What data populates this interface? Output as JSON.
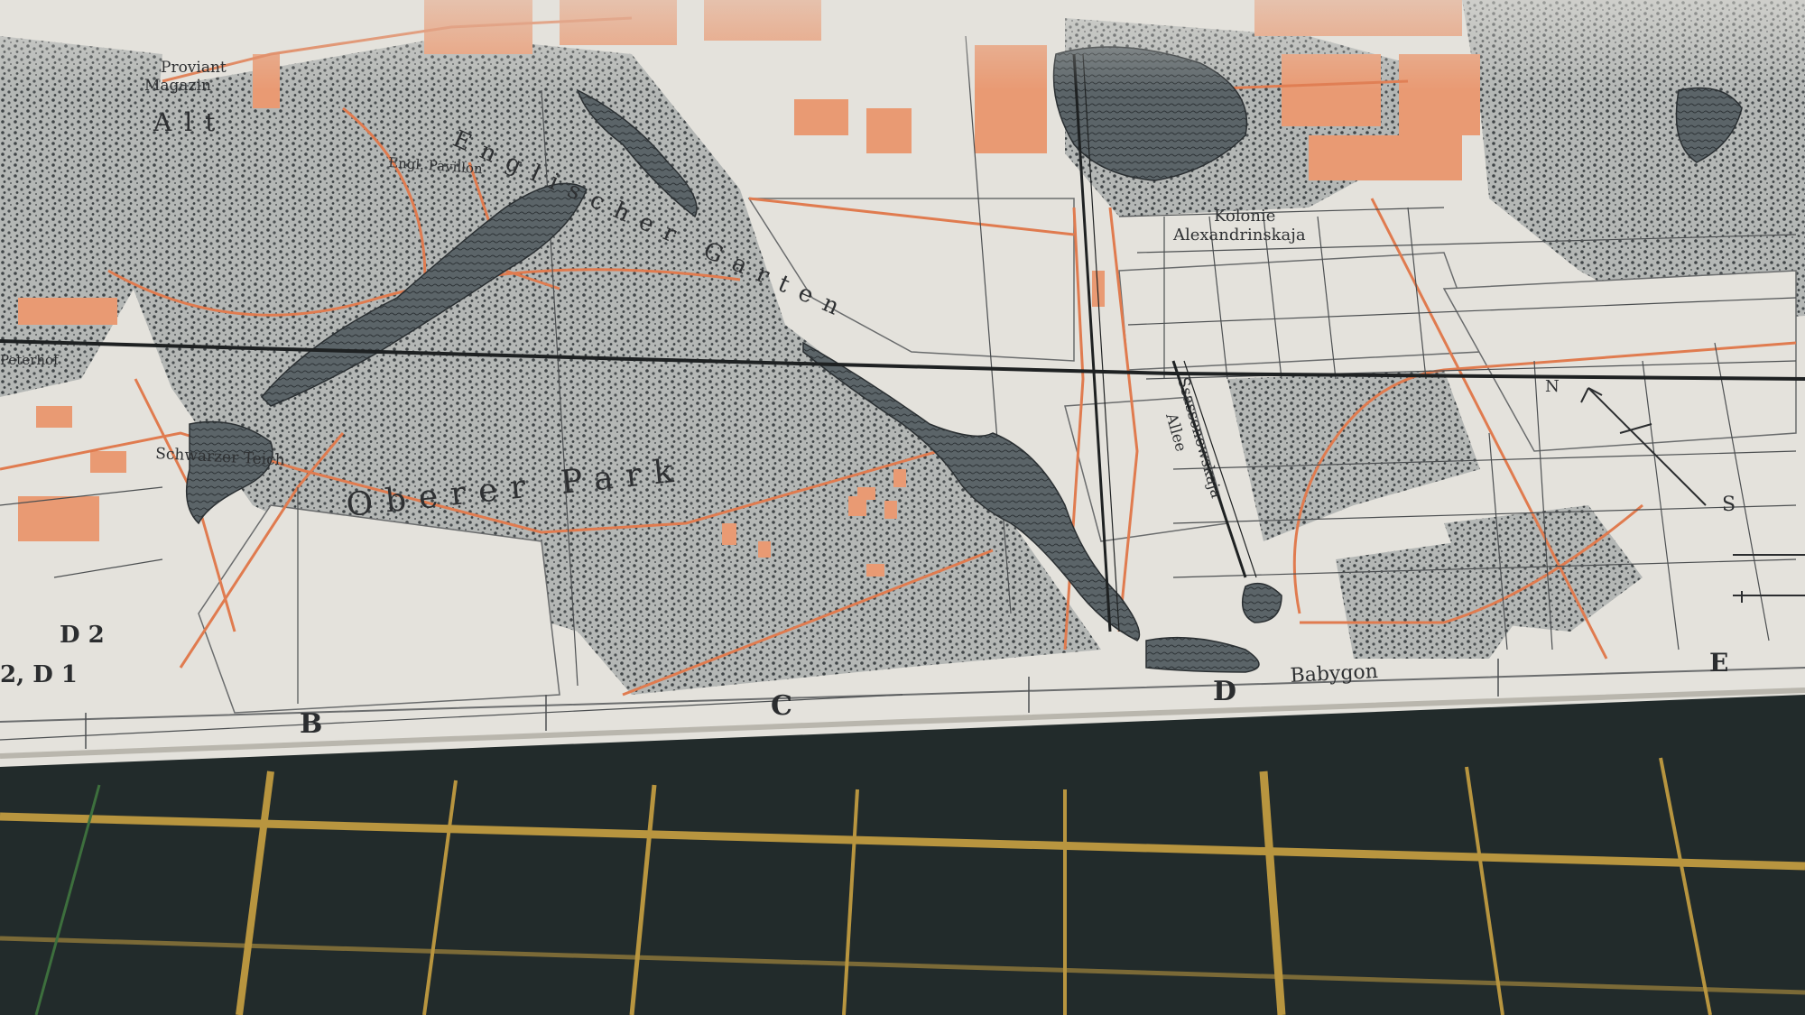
{
  "map": {
    "labels": {
      "proviant_line1": "Proviant",
      "proviant_line2": "Magazin",
      "kolonie_line1": "Kolonie",
      "kolonie_line2": "Alexandrinskaja",
      "english_garden": "Englischer Garten",
      "engl_pavillon": "Engl. Pavillon",
      "schwarzer_teich": "Schwarzer Teich",
      "oberer_park": "Oberer Park",
      "peterhof": "Peterhof",
      "babygon": "Babygon",
      "sassonowskaja_line1": "Ssassonowskaja",
      "sassonowskaja_line2": "Allee",
      "alt": "Alt",
      "d2": "D 2",
      "d2d1": "2, D 1"
    },
    "grid_letters": [
      "B",
      "C",
      "D",
      "E"
    ],
    "compass": {
      "north": "N",
      "south": "S"
    }
  },
  "colors": {
    "paper": "#e4e2dc",
    "forest": "#8f9494",
    "roads": "#e07b4f",
    "buildings": "#e99a73",
    "water": "#50585c",
    "mat": "#222b2b",
    "mat_grid": "#b8953f"
  }
}
